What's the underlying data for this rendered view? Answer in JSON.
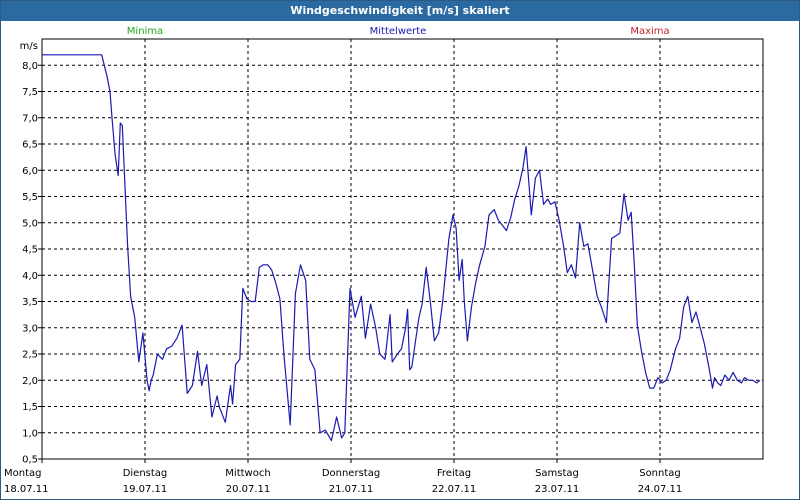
{
  "window": {
    "title": "Windgeschwindigkeit [m/s] skaliert"
  },
  "legend": {
    "min_label": "Minima",
    "min_color": "#22aa22",
    "mean_label": "Mittelwerte",
    "mean_color": "#1a1ab0",
    "max_label": "Maxima",
    "max_color": "#c0282d"
  },
  "chart_data": {
    "type": "line",
    "title": "Windgeschwindigkeit [m/s] skaliert",
    "ylabel": "m/s",
    "ylim": [
      0.5,
      8.5
    ],
    "yticks": [
      "0,5",
      "1,0",
      "1,5",
      "2,0",
      "2,5",
      "3,0",
      "3,5",
      "4,0",
      "4,5",
      "5,0",
      "5,5",
      "6,0",
      "6,5",
      "7,0",
      "7,5",
      "8,0"
    ],
    "xlim": [
      0,
      7
    ],
    "day_labels": [
      {
        "day": "Montag",
        "date": "18.07.11"
      },
      {
        "day": "Dienstag",
        "date": "19.07.11"
      },
      {
        "day": "Mittwoch",
        "date": "20.07.11"
      },
      {
        "day": "Donnerstag",
        "date": "21.07.11"
      },
      {
        "day": "Freitag",
        "date": "22.07.11"
      },
      {
        "day": "Samstag",
        "date": "23.07.11"
      },
      {
        "day": "Sonntag",
        "date": "24.07.11"
      }
    ],
    "grid": true,
    "series": [
      {
        "name": "Mittelwerte",
        "color": "#1a1ab0",
        "x": [
          0.0,
          0.58,
          0.63,
          0.66,
          0.68,
          0.71,
          0.74,
          0.76,
          0.78,
          0.83,
          0.86,
          0.9,
          0.94,
          0.98,
          1.02,
          1.04,
          1.06,
          1.08,
          1.12,
          1.17,
          1.21,
          1.26,
          1.31,
          1.36,
          1.41,
          1.46,
          1.51,
          1.55,
          1.6,
          1.65,
          1.7,
          1.72,
          1.74,
          1.78,
          1.83,
          1.85,
          1.88,
          1.92,
          1.95,
          1.99,
          2.03,
          2.07,
          2.11,
          2.15,
          2.19,
          2.23,
          2.27,
          2.31,
          2.35,
          2.41,
          2.46,
          2.51,
          2.56,
          2.6,
          2.65,
          2.7,
          2.75,
          2.81,
          2.86,
          2.91,
          2.94,
          2.99,
          3.04,
          3.1,
          3.14,
          3.19,
          3.24,
          3.28,
          3.33,
          3.38,
          3.4,
          3.45,
          3.49,
          3.53,
          3.55,
          3.57,
          3.59,
          3.63,
          3.66,
          3.69,
          3.73,
          3.77,
          3.81,
          3.85,
          3.89,
          3.95,
          3.99,
          4.02,
          4.05,
          4.08,
          4.1,
          4.13,
          4.17,
          4.21,
          4.25,
          4.3,
          4.34,
          4.39,
          4.43,
          4.47,
          4.51,
          4.55,
          4.59,
          4.63,
          4.67,
          4.7,
          4.75,
          4.79,
          4.83,
          4.87,
          4.91,
          4.94,
          4.98,
          5.02,
          5.06,
          5.1,
          5.14,
          5.18,
          5.22,
          5.26,
          5.3,
          5.35,
          5.39,
          5.43,
          5.48,
          5.53,
          5.57,
          5.61,
          5.65,
          5.69,
          5.72,
          5.75,
          5.78,
          5.82,
          5.86,
          5.9,
          5.94,
          5.98,
          6.02,
          6.06,
          6.1,
          6.15,
          6.19,
          6.23,
          6.27,
          6.31,
          6.35,
          6.39,
          6.43,
          6.48,
          6.51,
          6.53,
          6.56,
          6.59,
          6.63,
          6.67,
          6.71,
          6.75,
          6.79,
          6.82,
          6.86,
          6.9,
          6.94,
          6.97
        ],
        "y": [
          8.2,
          8.2,
          7.8,
          7.5,
          7.0,
          6.3,
          5.9,
          6.9,
          6.85,
          4.6,
          3.6,
          3.2,
          2.35,
          2.9,
          2.0,
          1.8,
          2.0,
          2.1,
          2.5,
          2.4,
          2.6,
          2.65,
          2.8,
          3.05,
          1.75,
          1.9,
          2.55,
          1.9,
          2.3,
          1.3,
          1.7,
          1.5,
          1.4,
          1.2,
          1.9,
          1.55,
          2.3,
          2.4,
          3.75,
          3.55,
          3.5,
          3.5,
          4.15,
          4.2,
          4.2,
          4.1,
          3.85,
          3.55,
          2.45,
          1.15,
          3.65,
          4.2,
          3.9,
          2.4,
          2.2,
          1.0,
          1.05,
          0.85,
          1.3,
          0.9,
          1.0,
          3.75,
          3.2,
          3.6,
          2.8,
          3.45,
          3.0,
          2.5,
          2.4,
          3.25,
          2.35,
          2.5,
          2.6,
          3.0,
          3.35,
          2.2,
          2.25,
          2.8,
          3.2,
          3.45,
          4.15,
          3.5,
          2.75,
          2.9,
          3.5,
          4.7,
          5.15,
          4.9,
          3.9,
          4.3,
          3.5,
          2.75,
          3.4,
          3.85,
          4.2,
          4.55,
          5.15,
          5.25,
          5.05,
          4.95,
          4.85,
          5.1,
          5.45,
          5.7,
          6.05,
          6.45,
          5.15,
          5.85,
          6.0,
          5.35,
          5.45,
          5.35,
          5.4,
          5.05,
          4.6,
          4.05,
          4.2,
          3.95,
          5.0,
          4.55,
          4.6,
          4.05,
          3.6,
          3.4,
          3.1,
          4.7,
          4.75,
          4.8,
          5.55,
          5.05,
          5.2,
          4.2,
          3.05,
          2.55,
          2.15,
          1.85,
          1.85,
          2.05,
          1.95,
          2.0,
          2.2,
          2.6,
          2.8,
          3.4,
          3.6,
          3.1,
          3.3,
          3.0,
          2.7,
          2.2,
          1.85,
          2.05,
          1.95,
          1.9,
          2.1,
          2.0,
          2.15,
          2.0,
          1.95,
          2.05,
          2.0,
          2.0,
          1.95,
          2.0
        ]
      }
    ]
  }
}
